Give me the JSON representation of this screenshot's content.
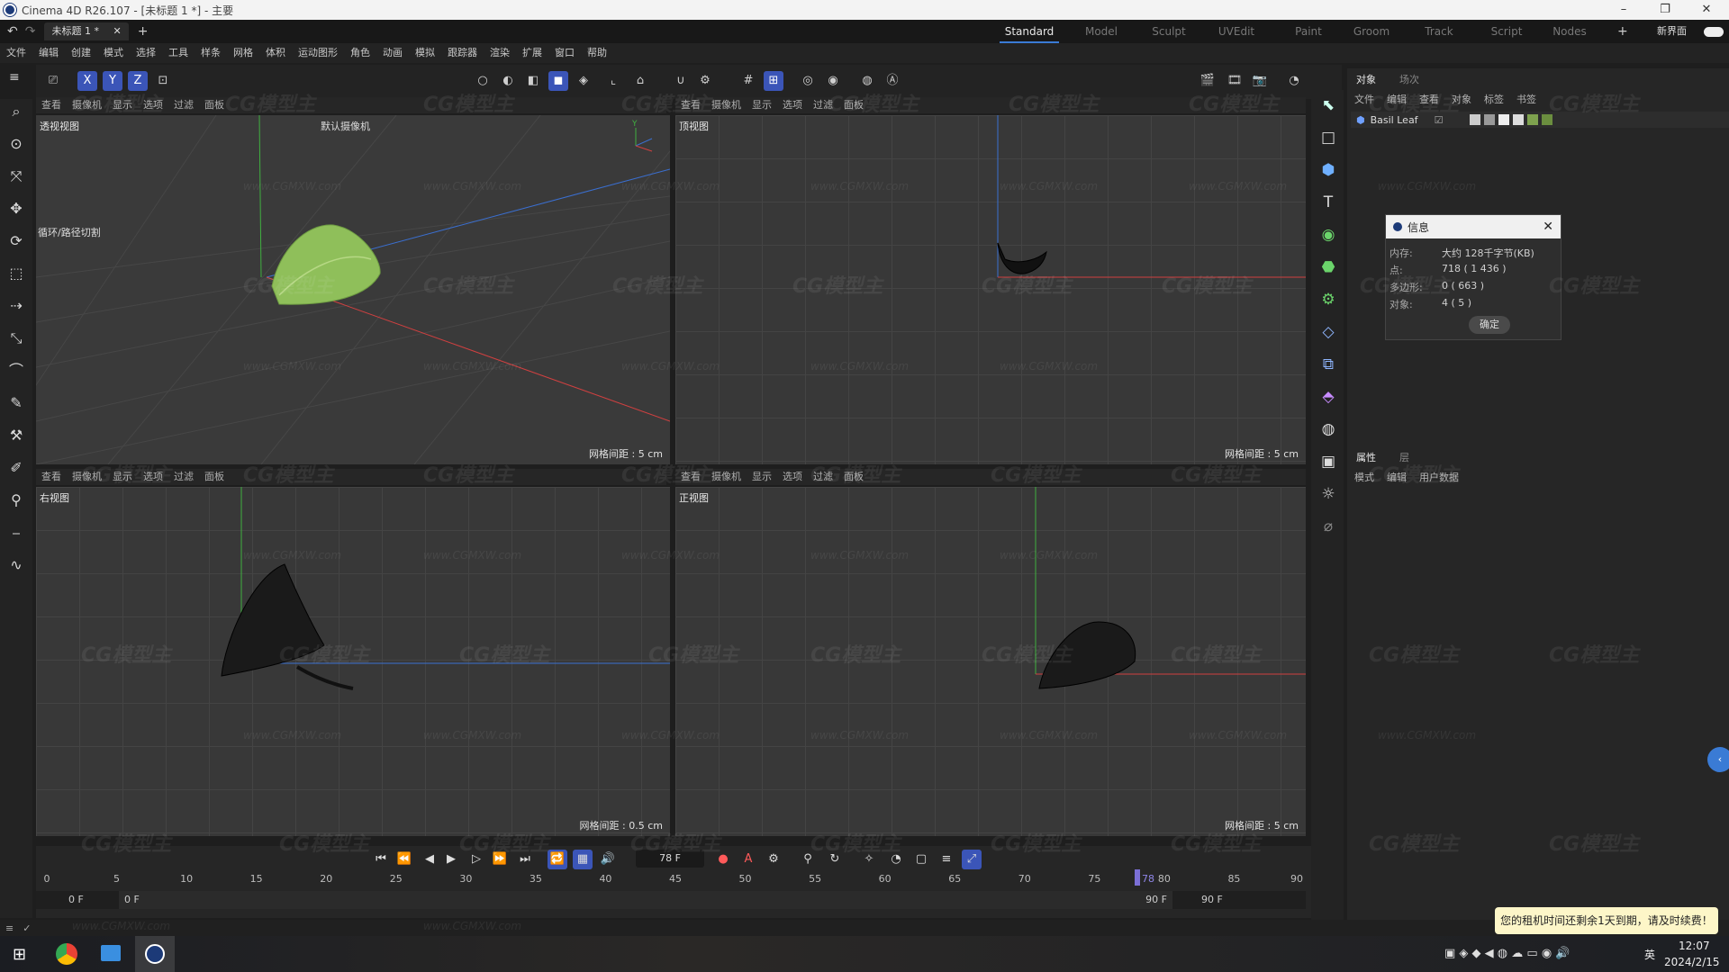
{
  "window": {
    "title": "Cinema 4D R26.107 - [未标题 1 *] - 主要",
    "minimize": "–",
    "restore": "❐",
    "close": "✕"
  },
  "tabs": {
    "doc_tab": "未标题 1 *",
    "add": "+",
    "layouts": [
      "Standard",
      "Model",
      "Sculpt",
      "UVEdit",
      "Paint",
      "Groom",
      "Track",
      "Script",
      "Nodes"
    ],
    "active_layout": "Standard",
    "new_interface": "新界面"
  },
  "menu": [
    "文件",
    "编辑",
    "创建",
    "模式",
    "选择",
    "工具",
    "样条",
    "网格",
    "体积",
    "运动图形",
    "角色",
    "动画",
    "模拟",
    "跟踪器",
    "渲染",
    "扩展",
    "窗口",
    "帮助"
  ],
  "viewport_menu": [
    "查看",
    "摄像机",
    "显示",
    "选项",
    "过滤",
    "面板"
  ],
  "viewports": {
    "perspective": {
      "name": "透视视图",
      "camera": "默认摄像机",
      "grid": "网格间距 : 5 cm",
      "hud": "循环/路径切割"
    },
    "top": {
      "name": "顶视图",
      "grid": "网格间距 : 5 cm"
    },
    "right": {
      "name": "右视图",
      "grid": "网格间距 : 0.5 cm"
    },
    "front": {
      "name": "正视图",
      "grid": "网格间距 : 5 cm"
    }
  },
  "axis_labels": {
    "x": "X",
    "y": "Y",
    "z": "Z"
  },
  "object_panel": {
    "tabs": [
      "对象",
      "场次"
    ],
    "menu": [
      "文件",
      "编辑",
      "查看",
      "对象",
      "标签",
      "书签"
    ],
    "object_name": "Basil Leaf"
  },
  "attr_panel": {
    "tabs": [
      "属性",
      "层"
    ],
    "menu": [
      "模式",
      "编辑",
      "用户数据"
    ]
  },
  "info_dialog": {
    "title": "信息",
    "rows": [
      {
        "key": "内存:",
        "value": "大约 128千字节(KB)"
      },
      {
        "key": "点:",
        "value": "718 ( 1 436 )"
      },
      {
        "key": "多边形:",
        "value": "0 ( 663 )"
      },
      {
        "key": "对象:",
        "value": "4 ( 5 )"
      }
    ],
    "ok": "确定"
  },
  "timeline": {
    "current_frame": "78 F",
    "ruler": [
      "0",
      "5",
      "10",
      "15",
      "20",
      "25",
      "30",
      "35",
      "40",
      "45",
      "50",
      "55",
      "60",
      "65",
      "70",
      "75",
      "80",
      "85",
      "90"
    ],
    "playhead_label": "78",
    "start": "0 F",
    "range_start": "0 F",
    "range_end": "90 F",
    "end": "90 F"
  },
  "notification": "您的租机时间还剩余1天到期，请及时续费！",
  "taskbar": {
    "ime": "英",
    "time": "12:07",
    "date": "2024/2/15"
  },
  "watermark": {
    "logo": "CG模型主",
    "url": "www.CGMXW.com"
  },
  "colors": {
    "accent": "#3a7bd5",
    "active_tool": "#3b55b8",
    "leaf": "#8fbf5a",
    "x_axis": "#d04040",
    "y_axis": "#40b040",
    "z_axis": "#3a6fd0"
  },
  "icons": {
    "undo": "↶",
    "redo": "↷",
    "toolbar": [
      "⎚",
      "X",
      "Y",
      "Z",
      "⊡",
      "○",
      "◐",
      "◧",
      "◼",
      "◈",
      "⌞",
      "⌂",
      "∪",
      "⚙",
      "#",
      "⊞",
      "◎",
      "◉",
      "◍",
      "Ⓐ",
      "🎬",
      "🎞",
      "📷",
      "◔"
    ],
    "left_tools": [
      "⌕",
      "⊙",
      "⤧",
      "✥",
      "⟳",
      "⬚",
      "⇢",
      "⤡",
      "⌒",
      "✎",
      "⚒",
      "✐",
      "⚲",
      "⎯",
      "∿"
    ],
    "right_column": [
      "⬉",
      "□",
      "⬢",
      "T",
      "◉",
      "⬣",
      "⚙",
      "◇",
      "⧉",
      "⬘",
      "◍",
      "▣",
      "☼",
      "⌀"
    ],
    "timeline": [
      "⏮",
      "⏪",
      "◀",
      "▶",
      "▷",
      "⏩",
      "⏭",
      "🔁",
      "▦",
      "🔊",
      "●",
      "A",
      "⚙",
      "⚲",
      "↻",
      "✧",
      "◔",
      "▢",
      "≡",
      "⤢"
    ]
  }
}
